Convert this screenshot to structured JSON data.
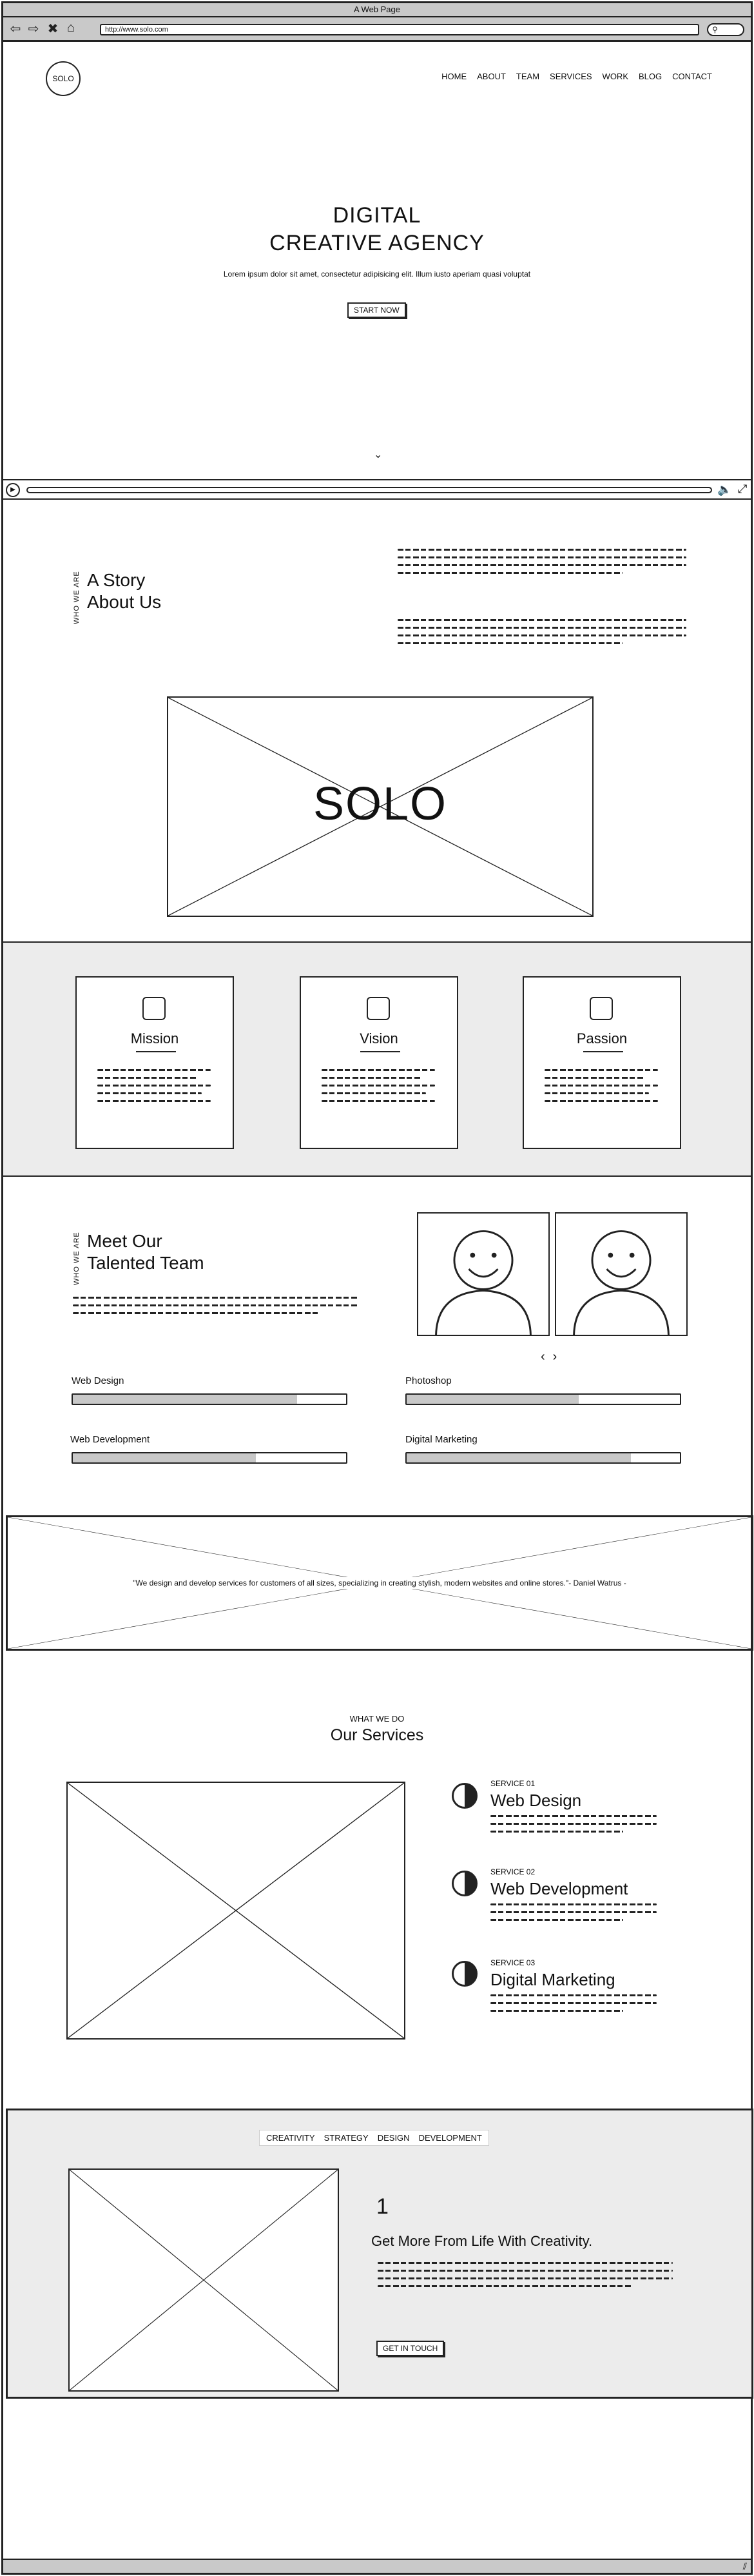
{
  "window": {
    "title": "A Web Page",
    "url": "http://www.solo.com",
    "search_icon": "search-icon"
  },
  "hero": {
    "logo": "SOLO",
    "menu": [
      "HOME",
      "ABOUT",
      "TEAM",
      "SERVICES",
      "WORK",
      "BLOG",
      "CONTACT"
    ],
    "title_line1": "DIGITAL",
    "title_line2": "CREATIVE AGENCY",
    "subtitle": "Lorem ipsum dolor sit amet, consectetur adipisicing elit. Illum iusto aperiam quasi voluptat",
    "cta": "START NOW",
    "scroll_icon": "chevron-down-icon"
  },
  "video": {
    "play_icon": "play-icon",
    "volume_icon": "volume-icon",
    "fullscreen_icon": "fullscreen-icon"
  },
  "about": {
    "kicker": "WHO WE ARE",
    "title_line1": "A Story",
    "title_line2": "About Us",
    "image_label": "SOLO"
  },
  "values": [
    {
      "title": "Mission",
      "icon": "square-icon"
    },
    {
      "title": "Vision",
      "icon": "square-icon"
    },
    {
      "title": "Passion",
      "icon": "square-icon"
    }
  ],
  "team": {
    "kicker": "WHO WE ARE",
    "title_line1": "Meet Our",
    "title_line2": "Talented Team",
    "prev": "‹",
    "next": "›",
    "skills": [
      {
        "label": "Web Design",
        "value": 0.82
      },
      {
        "label": "Photoshop",
        "value": 0.63
      },
      {
        "label": "Web Development",
        "value": 0.67
      },
      {
        "label": "Digital Marketing",
        "value": 0.82
      }
    ]
  },
  "quote": {
    "text": "\"We design and develop services for customers of all sizes, specializing in creating stylish, modern websites and online stores.\"- Daniel Watrus -"
  },
  "services": {
    "kicker": "WHAT WE DO",
    "title": "Our Services",
    "items": [
      {
        "kicker": "SERVICE 01",
        "title": "Web Design",
        "icon": "half-circle-icon"
      },
      {
        "kicker": "SERVICE 02",
        "title": "Web Development",
        "icon": "half-circle-icon"
      },
      {
        "kicker": "SERVICE 03",
        "title": "Digital Marketing",
        "icon": "half-circle-icon"
      }
    ]
  },
  "creativity": {
    "tabs": [
      "CREATIVITY",
      "STRATEGY",
      "DESIGN",
      "DEVELOPMENT"
    ],
    "number": "1",
    "title": "Get More From Life With Creativity.",
    "cta": "GET IN TOUCH"
  }
}
